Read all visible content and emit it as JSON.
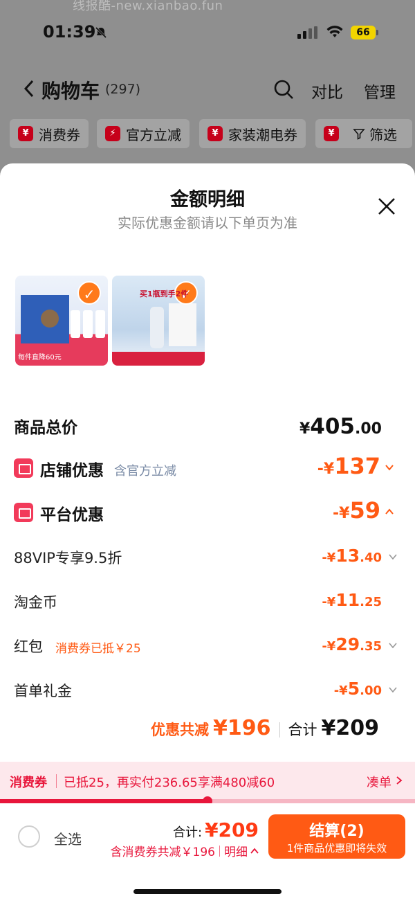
{
  "watermark": "线报酷-new.xianbao.fun",
  "status_bar": {
    "time": "01:39",
    "battery": "66"
  },
  "nav": {
    "title": "购物车",
    "count": "(297)",
    "compare": "对比",
    "manage": "管理"
  },
  "chips": [
    {
      "badge": "¥",
      "label": "消费券"
    },
    {
      "badge": "⚡",
      "label": "官方立减"
    },
    {
      "badge": "¥",
      "label": "家装潮电券"
    },
    {
      "badge": "¥",
      "label": ""
    }
  ],
  "filter_label": "筛选",
  "sheet": {
    "title": "金额明细",
    "subtitle": "实际优惠金额请以下单页为准"
  },
  "products": [
    {
      "caption": "每件直降60元"
    },
    {
      "caption": "买1瓶到手2件"
    }
  ],
  "total_price": {
    "label": "商品总价",
    "yen": "¥",
    "int": "405",
    "dec": ".00"
  },
  "store_discount": {
    "label": "店铺优惠",
    "note": "含官方立减",
    "amount_prefix": "-¥",
    "amount": "137"
  },
  "platform_discount": {
    "label": "平台优惠",
    "amount_prefix": "-¥",
    "amount": "59"
  },
  "sub_items": [
    {
      "label": "88VIP专享9.5折",
      "note": "",
      "prefix": "-¥",
      "int": "13",
      "dec": ".40",
      "chevron": true
    },
    {
      "label": "淘金币",
      "note": "",
      "prefix": "-¥",
      "int": "11",
      "dec": ".25",
      "chevron": false
    },
    {
      "label": "红包",
      "note": "消费券已抵￥25",
      "prefix": "-¥",
      "int": "29",
      "dec": ".35",
      "chevron": true
    },
    {
      "label": "首单礼金",
      "note": "",
      "prefix": "-¥",
      "int": "5",
      "dec": ".00",
      "chevron": true
    }
  ],
  "summary": {
    "discount_label": "优惠共减",
    "discount_amount": "¥196",
    "total_label": "合计",
    "total_amount": "¥209"
  },
  "coupon_bar": {
    "tag": "消费券",
    "text": "已抵25，再实付236.65享满480减60",
    "action": "凑单",
    "progress": 0.5
  },
  "bottom_bar": {
    "select_all": "全选",
    "total_label": "合计:",
    "total_amount": "¥209",
    "detail_text": "含消费券共减￥196",
    "detail_link": "明细",
    "checkout_main": "结算(2)",
    "checkout_sub": "1件商品优惠即将失效"
  },
  "colors": {
    "accent": "#ff5a14",
    "red": "#e8163b",
    "brand_pink": "#f23a5a"
  }
}
